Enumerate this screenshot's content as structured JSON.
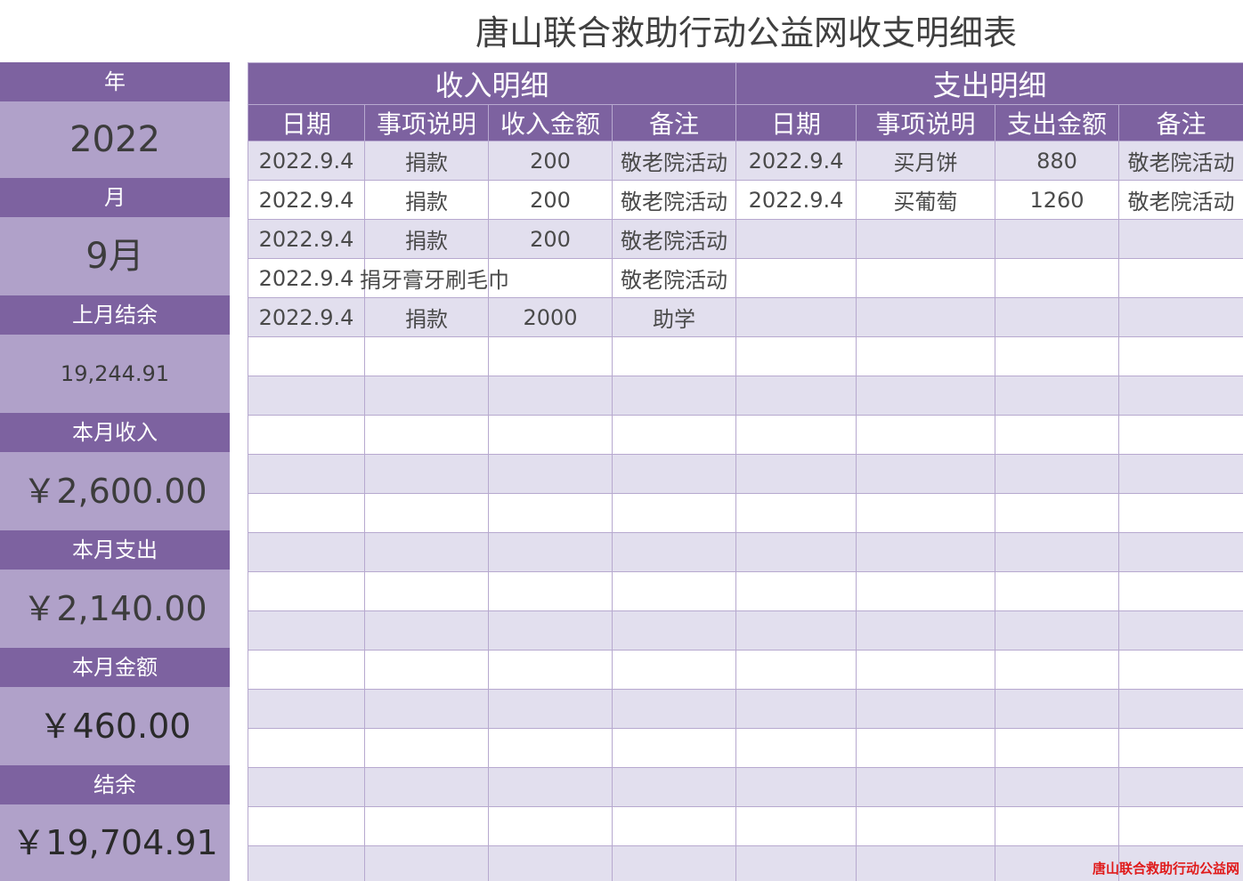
{
  "title": "唐山联合救助行动公益网收支明细表",
  "summary": {
    "year_label": "年",
    "year_value": "2022",
    "month_label": "月",
    "month_value": "9月",
    "prev_balance_label": "上月结余",
    "prev_balance_value": "19,244.91",
    "income_label": "本月收入",
    "income_value": "￥2,600.00",
    "expense_label": "本月支出",
    "expense_value": "￥2,140.00",
    "net_label": "本月金额",
    "net_value": "￥460.00",
    "balance_label": "结余",
    "balance_value": "￥19,704.91"
  },
  "income": {
    "section_title": "收入明细",
    "headers": [
      "日期",
      "事项说明",
      "收入金额",
      "备注"
    ],
    "rows": [
      [
        "2022.9.4",
        "捐款",
        "200",
        "敬老院活动"
      ],
      [
        "2022.9.4",
        "捐款",
        "200",
        "敬老院活动"
      ],
      [
        "2022.9.4",
        "捐款",
        "200",
        "敬老院活动"
      ],
      [
        "2022.9.4",
        "捐牙膏牙刷毛巾",
        "",
        "敬老院活动"
      ],
      [
        "2022.9.4",
        "捐款",
        "2000",
        "助学"
      ]
    ]
  },
  "expense": {
    "section_title": "支出明细",
    "headers": [
      "日期",
      "事项说明",
      "支出金额",
      "备注"
    ],
    "rows": [
      [
        "2022.9.4",
        "买月饼",
        "880",
        "敬老院活动"
      ],
      [
        "2022.9.4",
        "买葡萄",
        "1260",
        "敬老院活动"
      ]
    ]
  },
  "watermark": "唐山联合救助行动公益网",
  "colors": {
    "header_purple": "#7d62a0",
    "value_lavender": "#b0a1c9",
    "stripe": "#e2dfee",
    "watermark_red": "#e01b1b"
  }
}
